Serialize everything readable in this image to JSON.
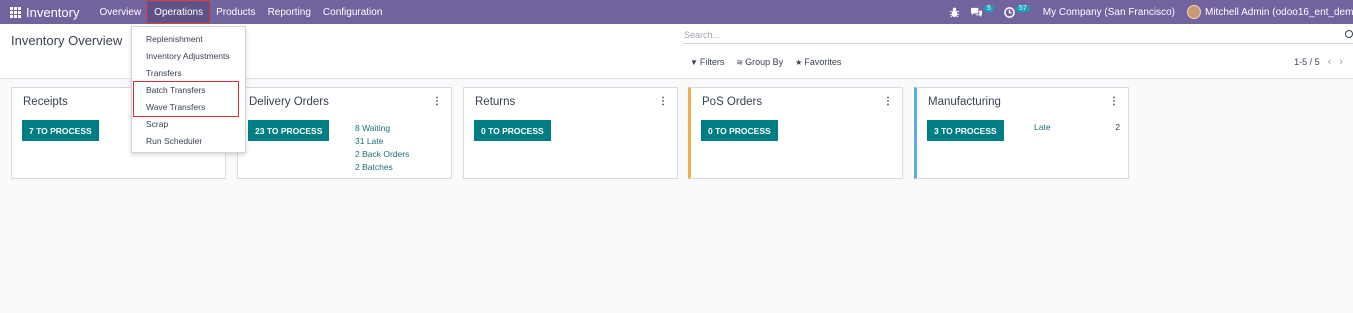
{
  "navbar": {
    "app_name": "Inventory",
    "menus": [
      "Overview",
      "Operations",
      "Products",
      "Reporting",
      "Configuration"
    ],
    "messages_count": "5",
    "activities_count": "57",
    "company": "My Company (San Francisco)",
    "user": "Mitchell Admin (odoo16_ent_demo)"
  },
  "control": {
    "title": "Inventory Overview",
    "search_placeholder": "Search...",
    "filters_label": "Filters",
    "groupby_label": "Group By",
    "favorites_label": "Favorites",
    "pager": "1-5 / 5"
  },
  "cards": {
    "receipts": {
      "title": "Receipts",
      "button": "7 TO PROCESS"
    },
    "delivery": {
      "title": "Delivery Orders",
      "button": "23 TO PROCESS",
      "stats": [
        "8 Waiting",
        "31 Late",
        "2 Back Orders",
        "2 Batches"
      ]
    },
    "returns": {
      "title": "Returns",
      "button": "0 TO PROCESS"
    },
    "pos": {
      "title": "PoS Orders",
      "button": "0 TO PROCESS"
    },
    "manufacturing": {
      "title": "Manufacturing",
      "button": "3 TO PROCESS",
      "late_label": "Late",
      "late_count": "2"
    }
  },
  "operations_menu": {
    "items": [
      "Replenishment",
      "Inventory Adjustments",
      "Transfers",
      "Batch Transfers",
      "Wave Transfers",
      "Scrap",
      "Run Scheduler"
    ]
  },
  "colors": {
    "navbar": "#71639e",
    "process_button": "#017e84",
    "highlight": "#d32f2f",
    "pos_accent": "#f0ad4e",
    "mfg_accent": "#5dade2"
  }
}
